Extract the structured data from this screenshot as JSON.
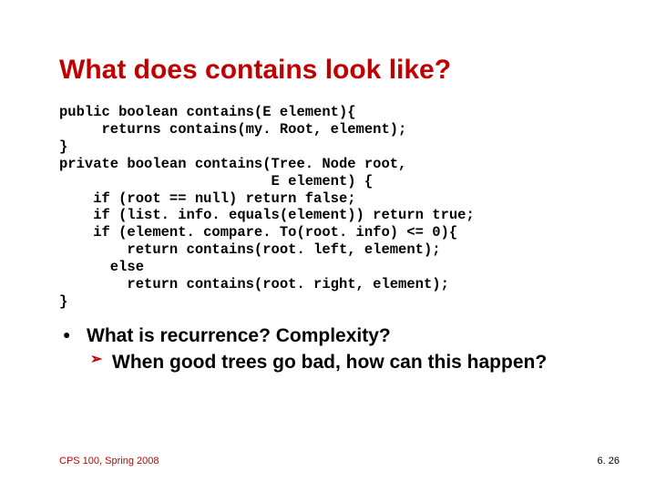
{
  "title": "What does contains look like?",
  "code": "public boolean contains(E element){\n     returns contains(my. Root, element);\n}\nprivate boolean contains(Tree. Node root,\n                         E element) {\n    if (root == null) return false;\n    if (list. info. equals(element)) return true;\n    if (element. compare. To(root. info) <= 0){\n        return contains(root. left, element);\n      else\n        return contains(root. right, element);\n}",
  "bullet": "What is recurrence? Complexity?",
  "subbullet": "When good trees go bad, how can this happen?",
  "footer_left": "CPS 100, Spring 2008",
  "footer_right": "6. 26"
}
